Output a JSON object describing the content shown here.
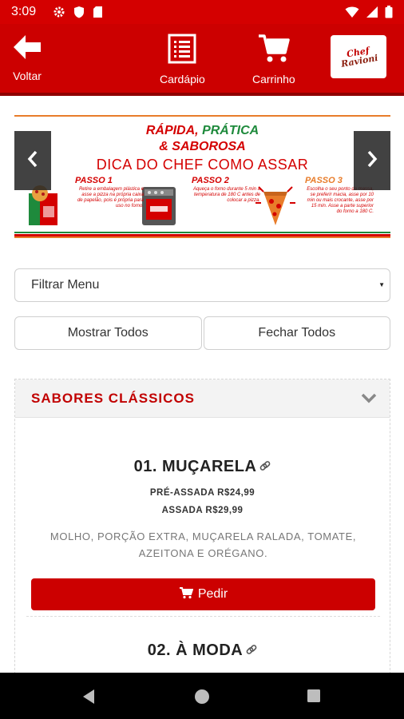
{
  "status_bar": {
    "time": "3:09",
    "left_icons": [
      "settings-icon",
      "shield-icon",
      "sd-card-icon"
    ],
    "right_icons": [
      "wifi-icon",
      "signal-icon",
      "battery-icon"
    ]
  },
  "header": {
    "back_label": "Voltar",
    "menu_label": "Cardápio",
    "cart_label": "Carrinho",
    "logo": "Chef Ravioni",
    "background_color": "#cc0000"
  },
  "banner": {
    "title_line1_part1": "RÁPIDA,",
    "title_line1_part2": "PRÁTICA",
    "title_line2": "& SABOROSA",
    "subtitle": "DICA DO CHEF COMO ASSAR",
    "steps": [
      {
        "title": "PASSO 1",
        "text": "Retire a embalagem plástica e asse a pizza na própria caixa de papelão, pois é própria para uso no forno."
      },
      {
        "title": "PASSO 2",
        "text": "Aqueça o forno durante 5 min a temperatura de 180 C antes de colocar a pizza."
      },
      {
        "title": "PASSO 3",
        "text": "Escolha o seu ponto da massa, se preferir macia, asse por 10 min ou mais crocante, asse por 15 min. Asse a parte superior do forno a 180 C."
      }
    ]
  },
  "filter": {
    "selected": "Filtrar Menu"
  },
  "buttons": {
    "show_all": "Mostrar Todos",
    "close_all": "Fechar Todos"
  },
  "section": {
    "title": "SABORES CLÁSSICOS",
    "items": [
      {
        "name": "01. MUÇARELA",
        "price_pre": "PRÉ-ASSADA R$24,99",
        "price_baked": "ASSADA R$29,99",
        "description": "MOLHO, PORÇÃO EXTRA, MUÇARELA RALADA, TOMATE, AZEITONA E ORÉGANO.",
        "order_label": "Pedir"
      },
      {
        "name": "02. À MODA"
      }
    ]
  },
  "colors": {
    "primary_red": "#cc0000",
    "title_red": "#c10000",
    "banner_green": "#1e8a3c",
    "banner_orange": "#e87c2a"
  }
}
